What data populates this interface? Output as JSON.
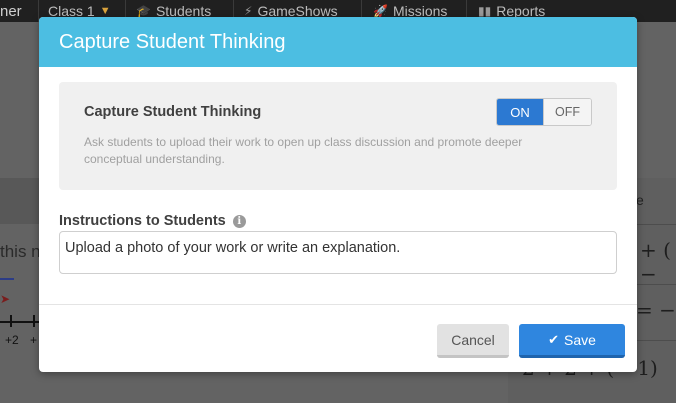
{
  "background": {
    "brand_fragment": "ner",
    "nav": {
      "class_label": "Class 1",
      "students_label": "Students",
      "gameshows_label": "GameShows",
      "missions_label": "Missions",
      "reports_label": "Reports"
    },
    "left_text": "this n",
    "number_labels": [
      "+2",
      "+"
    ],
    "math_fragments": [
      "+ ( −",
      "= −",
      "2 + 2 + (− 1)"
    ],
    "column_letter": "e"
  },
  "modal": {
    "title": "Capture Student Thinking",
    "setting": {
      "title": "Capture Student Thinking",
      "description": "Ask students to upload their work to open up class discussion and promote deeper conceptual understanding.",
      "toggle_on_label": "ON",
      "toggle_off_label": "OFF",
      "selected": "ON"
    },
    "instructions": {
      "label": "Instructions to Students",
      "value": "Upload a photo of your work or write an explanation."
    },
    "buttons": {
      "cancel_label": "Cancel",
      "save_label": "Save"
    }
  },
  "colors": {
    "header": "#4cbee2",
    "toggle_on": "#2c79d2",
    "save_button": "#2f86df"
  }
}
